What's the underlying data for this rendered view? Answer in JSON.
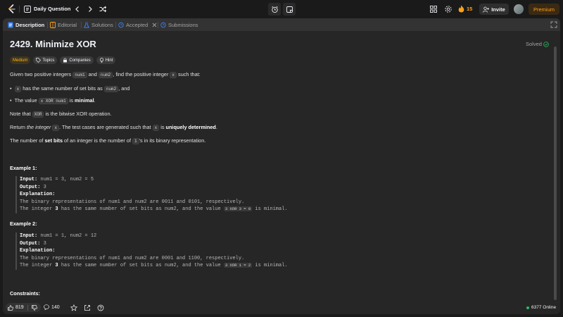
{
  "topbar": {
    "daily_label": "Daily Question",
    "streak_count": "15",
    "invite_label": "Invite",
    "premium_label": "Premium"
  },
  "tabs": [
    {
      "label": "Description"
    },
    {
      "label": "Editorial"
    },
    {
      "label": "Solutions"
    },
    {
      "label": "Accepted"
    },
    {
      "label": "Submissions"
    }
  ],
  "problem": {
    "title": "2429. Minimize XOR",
    "status": "Solved",
    "difficulty": "Medium",
    "chips": [
      "Topics",
      "Companies",
      "Hint"
    ],
    "intro": {
      "t1": "Given two positive integers ",
      "c1": "num1",
      "t2": " and ",
      "c2": "num2",
      "t3": ", find the positive integer ",
      "c3": "x",
      "t4": " such that:"
    },
    "bullet1": {
      "c1": "x",
      "t1": " has the same number of set bits as ",
      "c2": "num2",
      "t2": ", and"
    },
    "bullet2": {
      "t1": "The value ",
      "c1": "x XOR num1",
      "t2": " is ",
      "b1": "minimal",
      "t3": "."
    },
    "note": {
      "t1": "Note that ",
      "c1": "XOR",
      "t2": " is the bitwise XOR operation."
    },
    "return": {
      "t1": "Return ",
      "i1": "the integer",
      "c1": "x",
      "t2": ". The test cases are generated such that ",
      "c2": "x",
      "t3": " is ",
      "b1": "uniquely determined",
      "t4": "."
    },
    "setbits": {
      "t1": "The number of ",
      "b1": "set bits",
      "t2": " of an integer is the number of ",
      "c1": "1",
      "t3": "'s in its binary representation."
    },
    "examples": [
      {
        "title": "Example 1:",
        "input_label": "Input:",
        "input": " num1 = 3, num2 = 5",
        "output_label": "Output:",
        "output": " 3",
        "explanation_label": "Explanation:",
        "line1": "The binary representations of num1 and num2 are 0011 and 0101, respectively.",
        "line2a": "The integer ",
        "line2b": "3",
        "line2c": " has the same number of set bits as num2, and the value ",
        "line2code": "3 XOR 3 = 0",
        "line2d": " is minimal."
      },
      {
        "title": "Example 2:",
        "input_label": "Input:",
        "input": " num1 = 1, num2 = 12",
        "output_label": "Output:",
        "output": " 3",
        "explanation_label": "Explanation:",
        "line1": "The binary representations of num1 and num2 are 0001 and 1100, respectively.",
        "line2a": "The integer ",
        "line2b": "3",
        "line2c": " has the same number of set bits as num2, and the value ",
        "line2code": "3 XOR 1 = 2",
        "line2d": " is minimal."
      }
    ],
    "constraints_title": "Constraints:"
  },
  "bottombar": {
    "likes": "819",
    "comments": "140",
    "online": "6377 Online"
  },
  "colors": {
    "accent": "#ffa116",
    "solved_green": "#2cbb5d",
    "medium": "#ffb800",
    "tab_blue": "#3b82f6"
  }
}
